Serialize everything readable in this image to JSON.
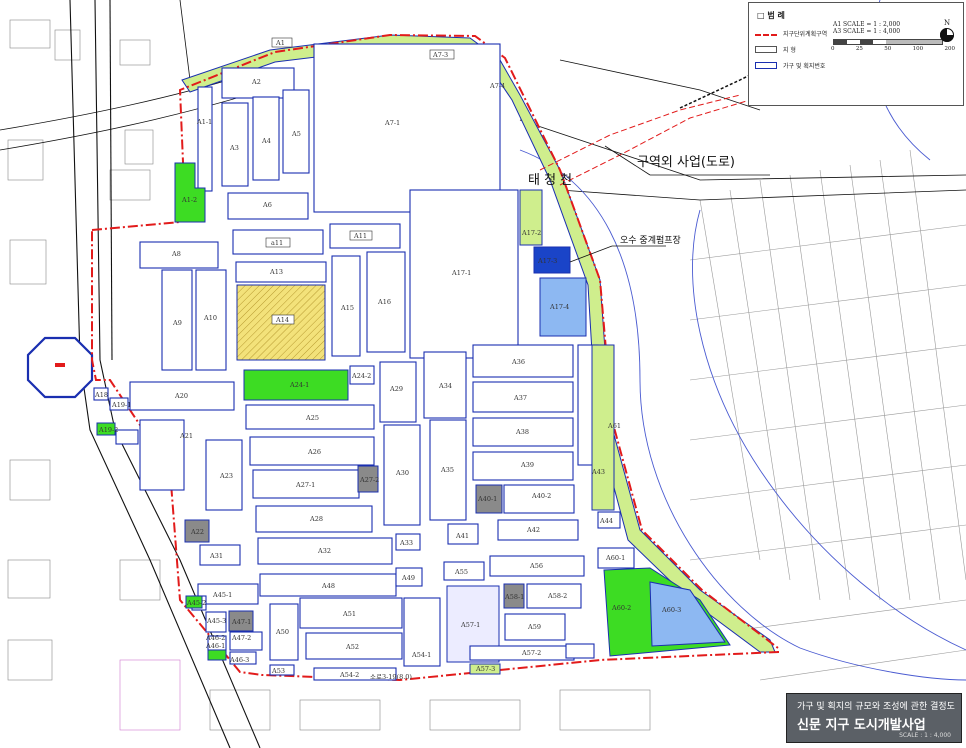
{
  "legend": {
    "title": "□ 범   례",
    "items": [
      {
        "label": "지구단위계획구역"
      },
      {
        "label": "지      형"
      },
      {
        "label": "가구 및 획지번호"
      }
    ],
    "scale_a1": "A1 SCALE = 1 : 2,000",
    "scale_a3": "A3 SCALE = 1 : 4,000",
    "scale_ticks": [
      "0",
      "25",
      "50",
      "100",
      "200"
    ],
    "north": "N"
  },
  "annotations": {
    "outside_project": "구역외 사업(도로)",
    "stream": "태  청  천",
    "pump_station": "오수 중계펌프장",
    "road_label": "소로3-19(8.0)"
  },
  "title_block": {
    "subtitle": "가구 및 획지의 규모와 조성에 관한 결정도",
    "title": "신문 지구 도시개발사업",
    "code": "SCALE : 1 : 4,000"
  },
  "colors": {
    "boundary": "#e21b1b",
    "block_outline": "#1a2fb0",
    "green": "#3ddc23",
    "light_green": "#cfee8d",
    "light_blue": "#8db8f2",
    "gray": "#8a8a8a",
    "hatch_yellow": "#f3e27a"
  },
  "map_labels": [
    "A1",
    "A1-1",
    "A1-2",
    "A2",
    "A3",
    "A4",
    "A5",
    "A6",
    "A7-1",
    "A7-3",
    "A7-4",
    "A8",
    "A9",
    "A10",
    "a11",
    "A11",
    "A13",
    "A14",
    "A15",
    "A16",
    "A17-1",
    "A17-2",
    "A17-3",
    "A17-4",
    "A18",
    "A19-1",
    "A19-2",
    "A20",
    "A21",
    "A22",
    "A23",
    "A24-1",
    "A24-2",
    "A25",
    "A26",
    "A27-1",
    "A27-2",
    "A28",
    "A29",
    "A30",
    "A31",
    "A32",
    "A33",
    "A34",
    "A35",
    "A36",
    "A37",
    "A38",
    "A39",
    "A40-1",
    "A40-2",
    "A41",
    "A42",
    "A43",
    "A44",
    "A45-1",
    "A45-2",
    "A45-3",
    "A46-1",
    "A46-2",
    "A46-3",
    "A47-1",
    "A47-2",
    "A48",
    "A49",
    "A50",
    "A51",
    "A52",
    "A53",
    "A54-1",
    "A54-2",
    "A55",
    "A56",
    "A57-1",
    "A57-2",
    "A57-3",
    "A58-1",
    "A58-2",
    "A59",
    "A60-1",
    "A60-2",
    "A60-3",
    "A61"
  ]
}
